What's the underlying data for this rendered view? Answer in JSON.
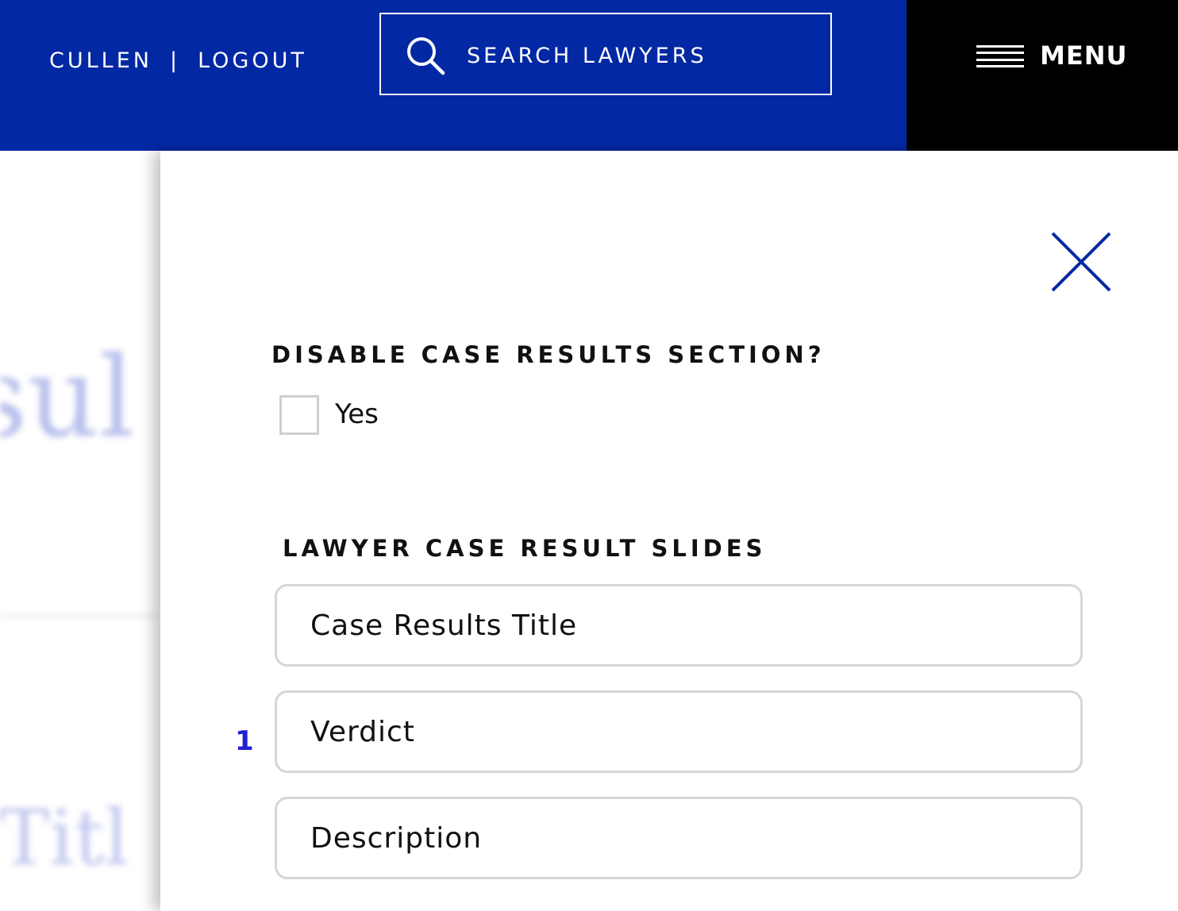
{
  "header": {
    "user_name": "CULLEN",
    "separator": "|",
    "logout_label": "LOGOUT",
    "search": {
      "placeholder": "SEARCH LAWYERS",
      "icon": "search-icon"
    },
    "menu": {
      "label": "MENU",
      "icon": "hamburger-icon"
    }
  },
  "background_page": {
    "text_fragment_1": "esul",
    "text_fragment_2": "ts Titl"
  },
  "panel": {
    "close_icon": "close-icon",
    "disable_section": {
      "heading": "DISABLE CASE RESULTS SECTION?",
      "checkbox_label": "Yes",
      "checked": false
    },
    "slides": {
      "heading": "LAWYER CASE RESULT SLIDES",
      "slide_number": "1",
      "fields": {
        "title_placeholder": "Case Results Title",
        "verdict_placeholder": "Verdict",
        "description_placeholder": "Description"
      }
    }
  },
  "colors": {
    "brand_blue": "#0328a3",
    "menu_black": "#000000",
    "accent_number": "#1e22d6",
    "field_border": "#d6d6d6"
  }
}
